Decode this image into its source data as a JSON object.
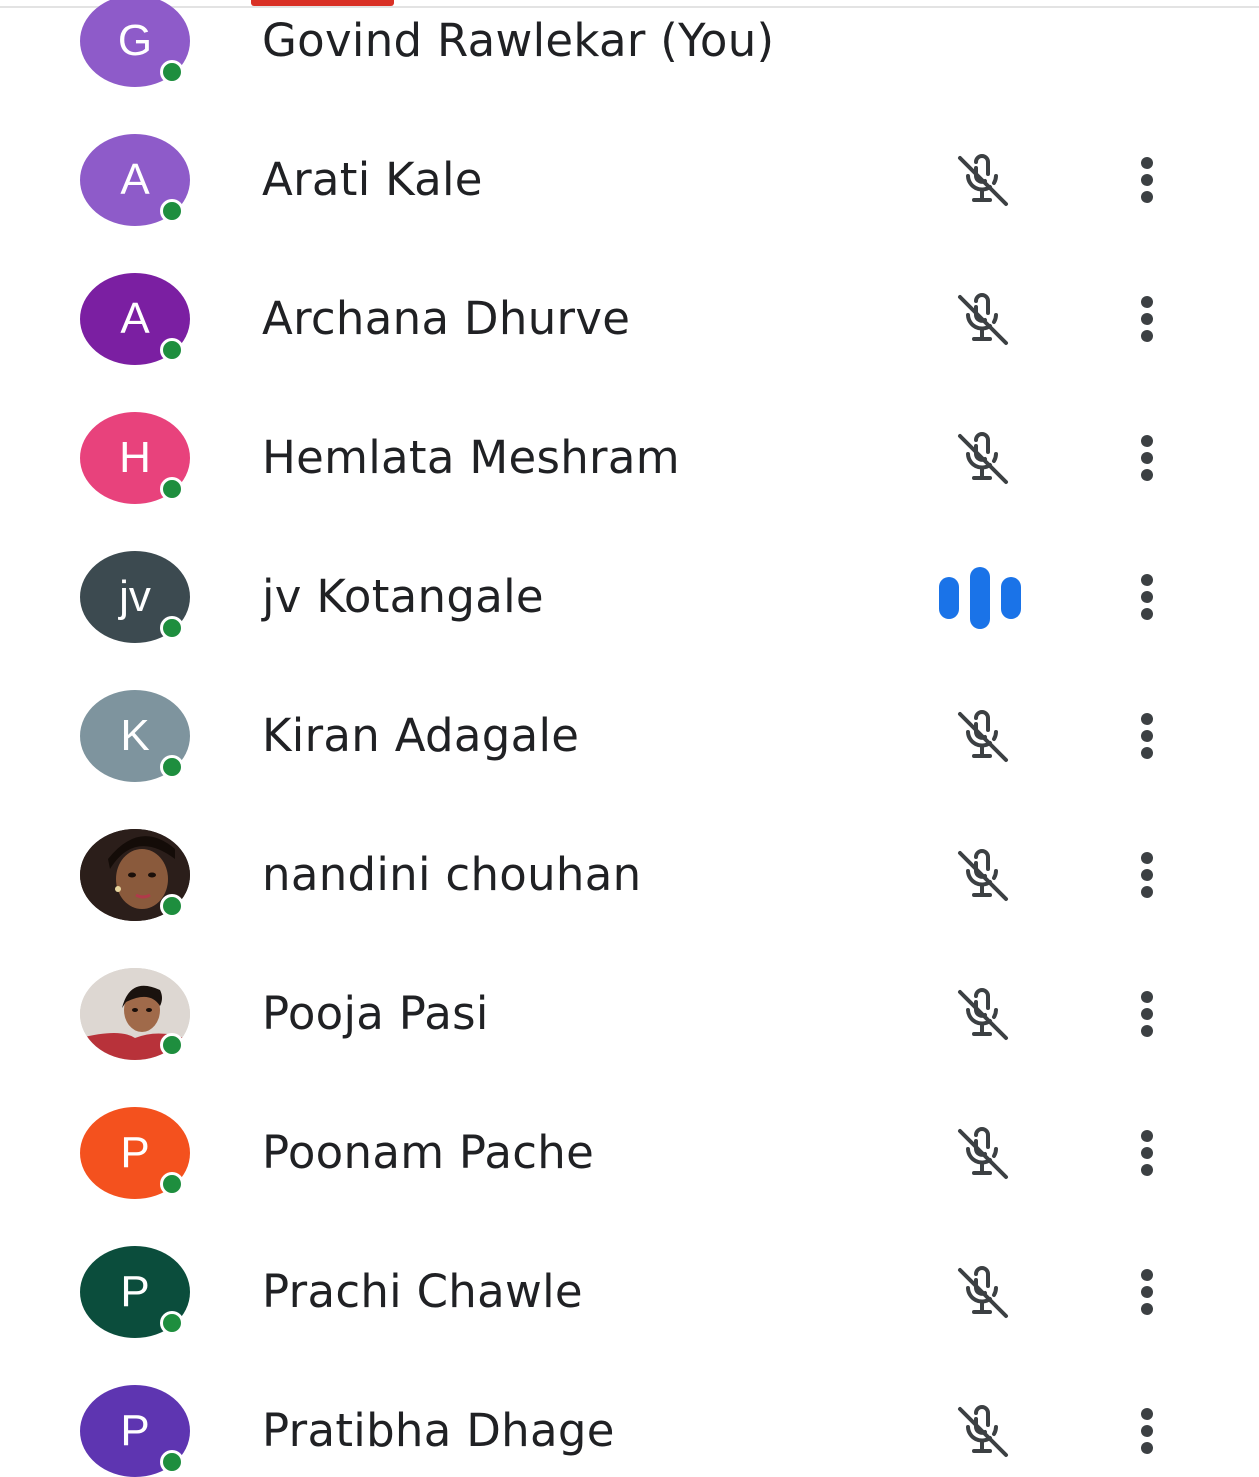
{
  "participants": [
    {
      "name": "Govind Rawlekar (You)",
      "initial": "G",
      "avatar_color": "#8e5bc9",
      "status": "self",
      "online": true
    },
    {
      "name": "Arati Kale",
      "initial": "A",
      "avatar_color": "#8e5bc9",
      "status": "muted",
      "online": true
    },
    {
      "name": "Archana Dhurve",
      "initial": "A",
      "avatar_color": "#7b1fa2",
      "status": "muted",
      "online": true
    },
    {
      "name": "Hemlata Meshram",
      "initial": "H",
      "avatar_color": "#e8427c",
      "status": "muted",
      "online": true
    },
    {
      "name": "jv Kotangale",
      "initial": "jv",
      "avatar_color": "#3c4a50",
      "status": "speaking",
      "online": true
    },
    {
      "name": "Kiran Adagale",
      "initial": "K",
      "avatar_color": "#7e949e",
      "status": "muted",
      "online": true
    },
    {
      "name": "nandini chouhan",
      "initial": "",
      "avatar_color": "#2b1e1a",
      "avatar_photo": "woman-portrait-photo",
      "status": "muted",
      "online": true
    },
    {
      "name": "Pooja Pasi",
      "initial": "",
      "avatar_color": "#d8d2cc",
      "avatar_photo": "girl-portrait-photo",
      "status": "muted",
      "online": true
    },
    {
      "name": "Poonam Pache",
      "initial": "P",
      "avatar_color": "#f4511e",
      "status": "muted",
      "online": true
    },
    {
      "name": "Prachi Chawle",
      "initial": "P",
      "avatar_color": "#0b4d3c",
      "status": "muted",
      "online": true
    },
    {
      "name": "Pratibha Dhage",
      "initial": "P",
      "avatar_color": "#5e35b1",
      "status": "muted",
      "online": true
    }
  ],
  "icons": {
    "muted": "mic-off-icon",
    "speaking": "audio-level-icon",
    "more": "more-vert-icon"
  },
  "colors": {
    "online_dot": "#1e8e3e",
    "speaking_accent": "#1a73e8",
    "icon_grey": "#3c4043",
    "tab_indicator": "#d93025"
  }
}
